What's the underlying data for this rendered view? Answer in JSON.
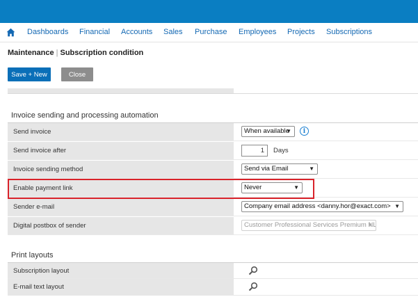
{
  "nav": {
    "home_icon": "home-icon",
    "items": [
      "Dashboards",
      "Financial",
      "Accounts",
      "Sales",
      "Purchase",
      "Employees",
      "Projects",
      "Subscriptions"
    ]
  },
  "breadcrumb": {
    "parent": "Maintenance",
    "separator": "|",
    "current": "Subscription condition"
  },
  "toolbar": {
    "save_new_label": "Save + New",
    "close_label": "Close"
  },
  "invoice_section": {
    "title": "Invoice sending and processing automation",
    "send_invoice": {
      "label": "Send invoice",
      "value": "When available",
      "info_icon": "info-icon"
    },
    "send_invoice_after": {
      "label": "Send invoice after",
      "value": "1",
      "unit": "Days"
    },
    "sending_method": {
      "label": "Invoice sending method",
      "value": "Send via Email"
    },
    "payment_link": {
      "label": "Enable payment link",
      "value": "Never"
    },
    "sender_email": {
      "label": "Sender e-mail",
      "value": "Company email address <danny.hor@exact.com>"
    },
    "digital_postbox": {
      "label": "Digital postbox of sender",
      "value": "Customer Professional Services Premium NL"
    }
  },
  "print_section": {
    "title": "Print layouts",
    "subscription_layout": {
      "label": "Subscription layout",
      "icon": "search-icon"
    },
    "email_text_layout": {
      "label": "E-mail text layout",
      "icon": "search-icon"
    }
  },
  "colors": {
    "topbar": "#0a7ec2",
    "nav_link": "#1368b3",
    "primary_button": "#0a6fb8",
    "secondary_button": "#8d8d8d",
    "highlight_border": "#d9222a",
    "label_background": "#e6e6e6"
  }
}
